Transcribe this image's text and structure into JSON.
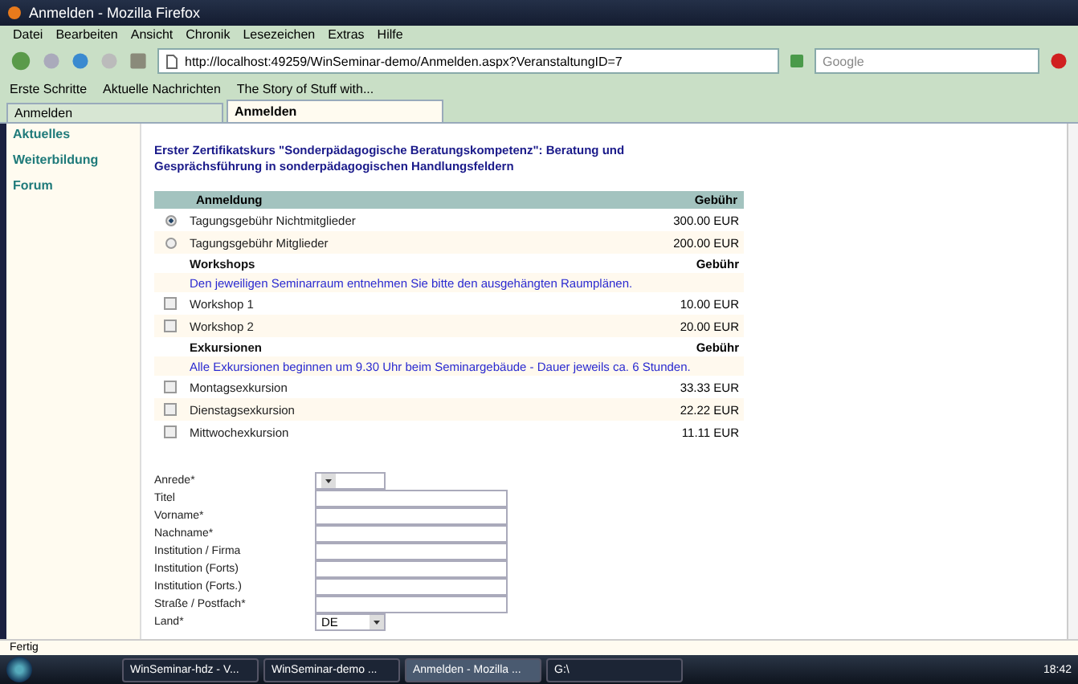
{
  "window": {
    "title": "Anmelden - Mozilla Firefox"
  },
  "menu": [
    "Datei",
    "Bearbeiten",
    "Ansicht",
    "Chronik",
    "Lesezeichen",
    "Extras",
    "Hilfe"
  ],
  "address": {
    "value": "http://localhost:49259/WinSeminar-demo/Anmelden.aspx?VeranstaltungID=7"
  },
  "search": {
    "placeholder": "Google"
  },
  "bookmarks": [
    "Erste Schritte",
    "Aktuelle Nachrichten",
    "The Story of Stuff with..."
  ],
  "tabs": [
    {
      "label": "Anmelden",
      "selected": false
    },
    {
      "label": "Anmelden",
      "selected": true
    }
  ],
  "sidebar": {
    "items": [
      "Aktuelles",
      "Weiterbildung",
      "Forum"
    ]
  },
  "course_title": "Erster Zertifikatskurs \"Sonderpädagogische Beratungskompetenz\": Beratung und Gesprächsführung in sonderpädagogischen Handlungsfeldern",
  "table": {
    "columns": [
      "Anmeldung",
      "Gebühr"
    ],
    "rows": [
      {
        "kind": "radio",
        "label": "Tagungsgebühr Nichtmitglieder",
        "fee": "300.00 EUR",
        "selected": true
      },
      {
        "kind": "radio",
        "label": "Tagungsgebühr Mitglieder",
        "fee": "200.00 EUR",
        "selected": false
      },
      {
        "kind": "heading",
        "label": "Workshops",
        "fee": "Gebühr"
      },
      {
        "kind": "note",
        "label": "Den jeweiligen Seminarraum entnehmen Sie bitte den ausgehängten Raumplänen."
      },
      {
        "kind": "check",
        "label": "Workshop 1",
        "fee": "10.00 EUR",
        "checked": false
      },
      {
        "kind": "check",
        "label": "Workshop 2",
        "fee": "20.00 EUR",
        "checked": false
      },
      {
        "kind": "heading",
        "label": "Exkursionen",
        "fee": "Gebühr"
      },
      {
        "kind": "note",
        "label": "Alle Exkursionen beginnen um 9.30 Uhr beim Seminargebäude - Dauer jeweils ca. 6 Stunden."
      },
      {
        "kind": "check",
        "label": "Montagsexkursion",
        "fee": "33.33 EUR",
        "checked": false
      },
      {
        "kind": "check",
        "label": "Dienstagsexkursion",
        "fee": "22.22 EUR",
        "checked": false
      },
      {
        "kind": "check",
        "label": "Mittwochexkursion",
        "fee": "11.11 EUR",
        "checked": false
      }
    ]
  },
  "form": [
    {
      "kind": "select",
      "label": "Anrede*"
    },
    {
      "kind": "text",
      "label": "Titel"
    },
    {
      "kind": "text",
      "label": "Vorname*"
    },
    {
      "kind": "text",
      "label": "Nachname*"
    },
    {
      "kind": "text",
      "label": "Institution / Firma"
    },
    {
      "kind": "text",
      "label": "Institution (Forts)"
    },
    {
      "kind": "text",
      "label": "Institution (Forts.)"
    },
    {
      "kind": "text",
      "label": "Straße / Postfach*"
    },
    {
      "kind": "select",
      "label": "Land*",
      "value": "DE"
    }
  ],
  "status_bar": "Fertig",
  "taskbar": {
    "items": [
      {
        "label": "WinSeminar-hdz - V...",
        "selected": false
      },
      {
        "label": "WinSeminar-demo ...",
        "selected": false
      },
      {
        "label": "Anmelden - Mozilla ...",
        "selected": true
      },
      {
        "label": "G:\\",
        "selected": false
      }
    ],
    "clock": "18:42"
  }
}
